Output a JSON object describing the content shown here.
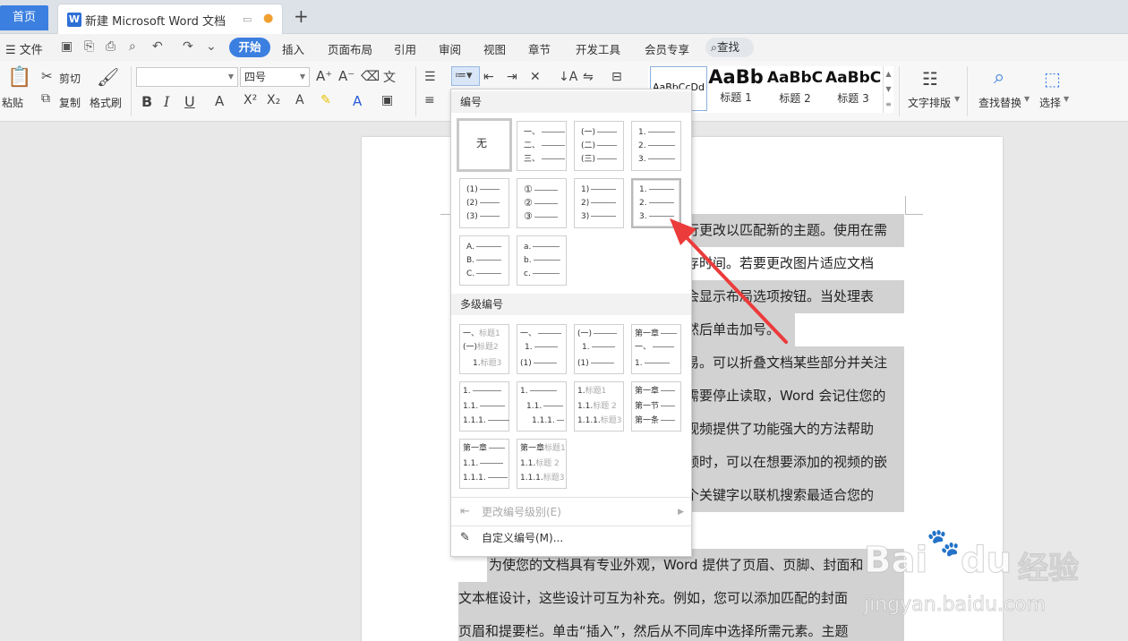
{
  "tabs": {
    "home": "首页",
    "doc_title": "新建 Microsoft Word 文档",
    "new_tab": "+"
  },
  "menu": {
    "file": "文件",
    "tabs": [
      "开始",
      "插入",
      "页面布局",
      "引用",
      "审阅",
      "视图",
      "章节",
      "开发工具",
      "会员专享"
    ],
    "search": "查找"
  },
  "ribbon": {
    "paste": "粘贴",
    "cut": "剪切",
    "copy": "复制",
    "format_painter": "格式刷",
    "font_name": "",
    "font_size": "四号",
    "style_normal": "AaBbCcDd",
    "styles": [
      {
        "sample": "AaBb",
        "label": "标题 1"
      },
      {
        "sample": "AaBbC",
        "label": "标题 2"
      },
      {
        "sample": "AaBbC",
        "label": "标题 3"
      }
    ],
    "text_layout": "文字排版",
    "find_replace": "查找替换",
    "select": "选择"
  },
  "dropdown": {
    "numbering_header": "编号",
    "multilevel_header": "多级编号",
    "none_label": "无",
    "change_level": "更改编号级别(E)",
    "custom_numbering": "自定义编号(M)...",
    "numbering_sets": [
      [
        "一、",
        "二、",
        "三、"
      ],
      [
        "(一)",
        "(二)",
        "(三)"
      ],
      [
        "1.",
        "2.",
        "3."
      ],
      [
        "(1)",
        "(2)",
        "(3)"
      ],
      [
        "①",
        "②",
        "③"
      ],
      [
        "1)",
        "2)",
        "3)"
      ],
      [
        "1.",
        "2.",
        "3."
      ],
      [
        "A.",
        "B.",
        "C."
      ],
      [
        "a.",
        "b.",
        "c."
      ]
    ],
    "multilevel_sets": [
      [
        [
          "一、",
          "标题1"
        ],
        [
          "(一)",
          "标题2"
        ],
        [
          "1.",
          "标题3"
        ]
      ],
      [
        [
          "一、",
          ""
        ],
        [
          "1.",
          ""
        ],
        [
          "(1)",
          ""
        ]
      ],
      [
        [
          "(一)",
          ""
        ],
        [
          "1.",
          ""
        ],
        [
          "(1)",
          ""
        ]
      ],
      [
        [
          "第一章",
          ""
        ],
        [
          "一、",
          ""
        ],
        [
          "1.",
          ""
        ]
      ],
      [
        [
          "1.",
          ""
        ],
        [
          "1.1.",
          ""
        ],
        [
          "1.1.1.",
          ""
        ]
      ],
      [
        [
          "1.",
          ""
        ],
        [
          "1.1.",
          ""
        ],
        [
          "1.1.1.",
          ""
        ]
      ],
      [
        [
          "1.",
          "标题1"
        ],
        [
          "1.1.",
          "标题 2"
        ],
        [
          "1.1.1.",
          "标题3"
        ]
      ],
      [
        [
          "第一章",
          ""
        ],
        [
          "第一节",
          ""
        ],
        [
          "第一条",
          ""
        ]
      ],
      [
        [
          "第一章",
          ""
        ],
        [
          "1.1.",
          ""
        ],
        [
          "1.1.1.",
          ""
        ]
      ],
      [
        [
          "第一章",
          "标题1"
        ],
        [
          "1.1.",
          "标题 2"
        ],
        [
          "1.1.1.",
          "标题3"
        ]
      ]
    ]
  },
  "document": {
    "lines": [
      "行更改以匹配新的主题。使用在需",
      "存时间。若要更改图片适应文档",
      "会显示布局选项按钮。当处理表",
      "然后单击加号。",
      "易。可以折叠文档某些部分并关注",
      "需要停止读取，Word 会记住您的",
      "视频提供了功能强大的方法帮助",
      "频时，可以在想要添加的视频的嵌",
      "个关键字以联机搜索最适合您的",
      "为使您的文档具有专业外观，Word 提供了页眉、页脚、封面和",
      "文本框设计，这些设计可互为补充。例如，您可以添加匹配的封面",
      "页眉和提要栏。单击“插入”，然后从不同库中选择所需元素。主题"
    ]
  },
  "watermark": {
    "brand": "Bai",
    "brand2": "du",
    "cn": "经验",
    "url": "jingyan.baidu.com"
  }
}
